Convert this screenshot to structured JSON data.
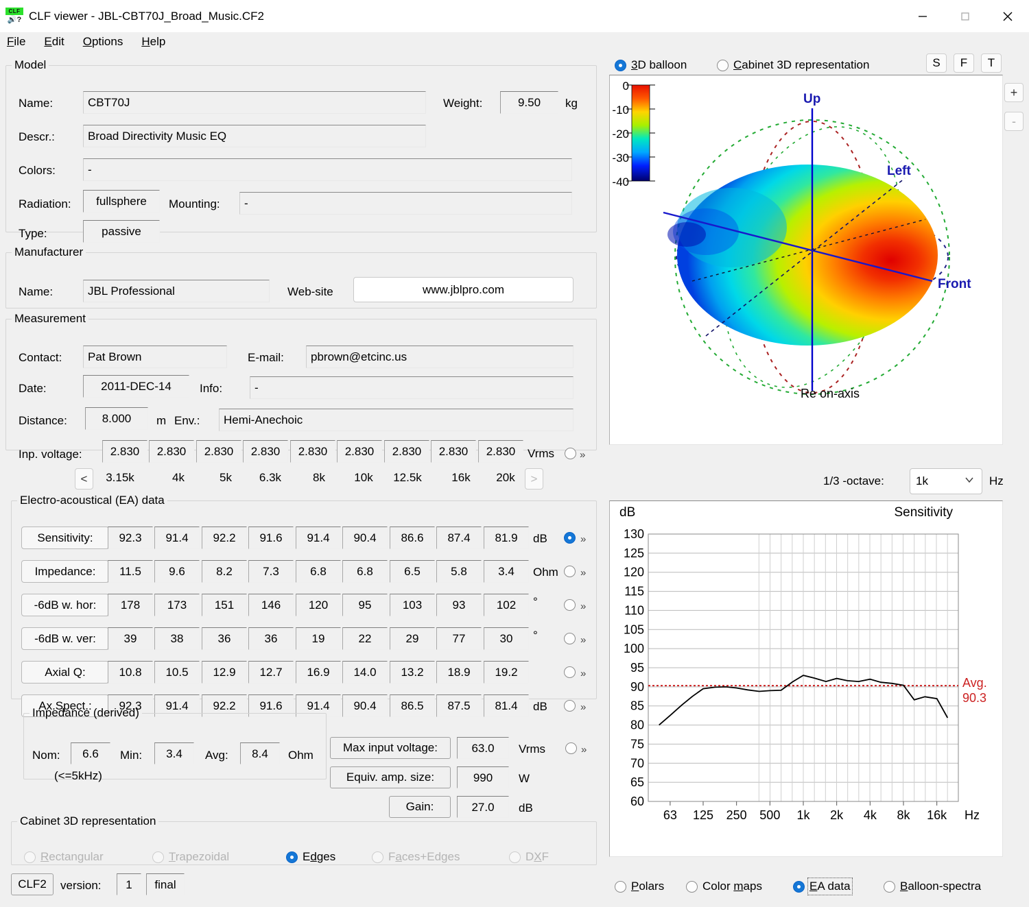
{
  "window": {
    "title": "CLF viewer - JBL-CBT70J_Broad_Music.CF2",
    "icon_top": "CLF",
    "icon_bottom": "?",
    "minimize": "minimize-icon",
    "maximize": "maximize-icon",
    "close": "close-icon"
  },
  "menu": [
    {
      "label": "File",
      "accel": "F"
    },
    {
      "label": "Edit",
      "accel": "E"
    },
    {
      "label": "Options",
      "accel": "O"
    },
    {
      "label": "Help",
      "accel": "H"
    }
  ],
  "model": {
    "legend": "Model",
    "name_label": "Name:",
    "name_value": "CBT70J",
    "weight_label": "Weight:",
    "weight_value": "9.50",
    "weight_unit": "kg",
    "descr_label": "Descr.:",
    "descr_value": "Broad Directivity  Music EQ",
    "colors_label": "Colors:",
    "colors_value": "-",
    "radiation_label": "Radiation:",
    "radiation_value": "fullsphere",
    "mounting_label": "Mounting:",
    "mounting_value": "-",
    "type_label": "Type:",
    "type_value": "passive"
  },
  "manufacturer": {
    "legend": "Manufacturer",
    "name_label": "Name:",
    "name_value": "JBL Professional",
    "website_label": "Web-site",
    "website_value": "www.jblpro.com"
  },
  "measurement": {
    "legend": "Measurement",
    "contact_label": "Contact:",
    "contact_value": "Pat Brown",
    "email_label": "E-mail:",
    "email_value": "pbrown@etcinc.us",
    "date_label": "Date:",
    "date_value": "2011-DEC-14",
    "info_label": "Info:",
    "info_value": "-",
    "distance_label": "Distance:",
    "distance_value": "8.000",
    "distance_unit": "m",
    "env_label": "Env.:",
    "env_value": "Hemi-Anechoic",
    "inp_voltage_label": "Inp. voltage:",
    "inp_voltage_values": [
      "2.830",
      "2.830",
      "2.830",
      "2.830",
      "2.830",
      "2.830",
      "2.830",
      "2.830",
      "2.830"
    ],
    "inp_voltage_unit": "Vrms"
  },
  "freq_nav": {
    "prev": "<",
    "next": ">",
    "bands": [
      "3.15k",
      "4k",
      "5k",
      "6.3k",
      "8k",
      "10k",
      "12.5k",
      "16k",
      "20k"
    ]
  },
  "ea": {
    "legend": "Electro-acoustical (EA) data",
    "rows": [
      {
        "label": "Sensitivity:",
        "unit": "dB",
        "selected": true,
        "values": [
          "92.3",
          "91.4",
          "92.2",
          "91.6",
          "91.4",
          "90.4",
          "86.6",
          "87.4",
          "81.9"
        ]
      },
      {
        "label": "Impedance:",
        "unit": "Ohm",
        "selected": false,
        "values": [
          "11.5",
          "9.6",
          "8.2",
          "7.3",
          "6.8",
          "6.8",
          "6.5",
          "5.8",
          "3.4"
        ]
      },
      {
        "label": "-6dB w. hor:",
        "unit": "°",
        "selected": false,
        "values": [
          "178",
          "173",
          "151",
          "146",
          "120",
          "95",
          "103",
          "93",
          "102"
        ]
      },
      {
        "label": "-6dB w. ver:",
        "unit": "°",
        "selected": false,
        "values": [
          "39",
          "38",
          "36",
          "36",
          "19",
          "22",
          "29",
          "77",
          "30"
        ]
      },
      {
        "label": "Axial Q:",
        "unit": "",
        "selected": false,
        "values": [
          "10.8",
          "10.5",
          "12.9",
          "12.7",
          "16.9",
          "14.0",
          "13.2",
          "18.9",
          "19.2"
        ]
      },
      {
        "label": "Ax.Spect.:",
        "unit": "dB",
        "selected": false,
        "values": [
          "92.3",
          "91.4",
          "92.2",
          "91.6",
          "91.4",
          "90.4",
          "86.5",
          "87.5",
          "81.4"
        ]
      }
    ]
  },
  "impedance_derived": {
    "legend": "Impedance (derived)",
    "nom_label": "Nom:",
    "nom_value": "6.6",
    "min_label": "Min:",
    "min_value": "3.4",
    "avg_label": "Avg:",
    "avg_value": "8.4",
    "unit": "Ohm",
    "note": "(<=5kHz)"
  },
  "power": {
    "max_input_label": "Max input voltage:",
    "max_input_value": "63.0",
    "max_input_unit": "Vrms",
    "amp_size_label": "Equiv. amp. size:",
    "amp_size_value": "990",
    "amp_size_unit": "W",
    "gain_label": "Gain:",
    "gain_value": "27.0",
    "gain_unit": "dB"
  },
  "cabinet": {
    "legend": "Cabinet 3D representation",
    "options": [
      {
        "label": "Rectangular",
        "accel": "R",
        "selected": false,
        "disabled": true
      },
      {
        "label": "Trapezoidal",
        "accel": "T",
        "selected": false,
        "disabled": true
      },
      {
        "label": "Edges",
        "accel": "d",
        "selected": true,
        "disabled": false
      },
      {
        "label": "Faces+Edges",
        "accel": "a",
        "selected": false,
        "disabled": true
      },
      {
        "label": "DXF",
        "accel": "X",
        "selected": false,
        "disabled": true
      }
    ]
  },
  "version_bar": {
    "format": "CLF2",
    "version_label": "version:",
    "version_value": "1",
    "status": "final"
  },
  "viewer": {
    "mode_options": [
      {
        "label": "3D balloon",
        "accel": "3",
        "selected": true
      },
      {
        "label": "Cabinet 3D representation",
        "accel": "C",
        "selected": false
      }
    ],
    "toolbuttons": [
      "S",
      "F",
      "T"
    ],
    "zoom_in": "+",
    "zoom_out": "-",
    "balloon": {
      "scale_ticks": [
        "0",
        "-10",
        "-20",
        "-30",
        "-40"
      ],
      "axis_labels": [
        "Up",
        "Left",
        "Front"
      ],
      "caption": "Re on-axis"
    },
    "octave_label": "1/3 -octave:",
    "octave_value": "1k",
    "octave_unit": "Hz"
  },
  "bottom_tabs": [
    {
      "label": "Polars",
      "accel": "P",
      "selected": false
    },
    {
      "label": "Color maps",
      "accel": "m",
      "selected": false
    },
    {
      "label": "EA data",
      "accel": "E",
      "selected": true
    },
    {
      "label": "Balloon-spectra",
      "accel": "B",
      "selected": false
    }
  ],
  "chart_data": {
    "type": "line",
    "title": "Sensitivity",
    "xlabel": "Hz",
    "ylabel": "dB",
    "ylim": [
      60,
      130
    ],
    "ytick_step": 5,
    "yticks": [
      60,
      65,
      70,
      75,
      80,
      85,
      90,
      95,
      100,
      105,
      110,
      115,
      120,
      125,
      130
    ],
    "xticks_labeled": [
      "63",
      "125",
      "250",
      "500",
      "1k",
      "2k",
      "4k",
      "8k",
      "16k"
    ],
    "x": [
      50,
      63,
      80,
      100,
      125,
      160,
      200,
      250,
      315,
      400,
      500,
      630,
      800,
      1000,
      1250,
      1600,
      2000,
      2500,
      3150,
      4000,
      5000,
      6300,
      8000,
      10000,
      12500,
      16000,
      20000
    ],
    "values": [
      80.0,
      82.5,
      85.2,
      87.5,
      89.5,
      89.9,
      90.0,
      89.7,
      89.2,
      88.8,
      89.0,
      89.1,
      91.3,
      93.0,
      92.3,
      91.4,
      92.2,
      91.6,
      91.4,
      92.0,
      91.2,
      90.9,
      90.4,
      86.6,
      87.4,
      86.9,
      81.9
    ],
    "grid": true,
    "average_line": {
      "value": 90.3,
      "label": "Avg.",
      "value_label": "90.3",
      "color": "#cc2222",
      "style": "dotted"
    },
    "line_color": "#000000",
    "legend": "none"
  }
}
